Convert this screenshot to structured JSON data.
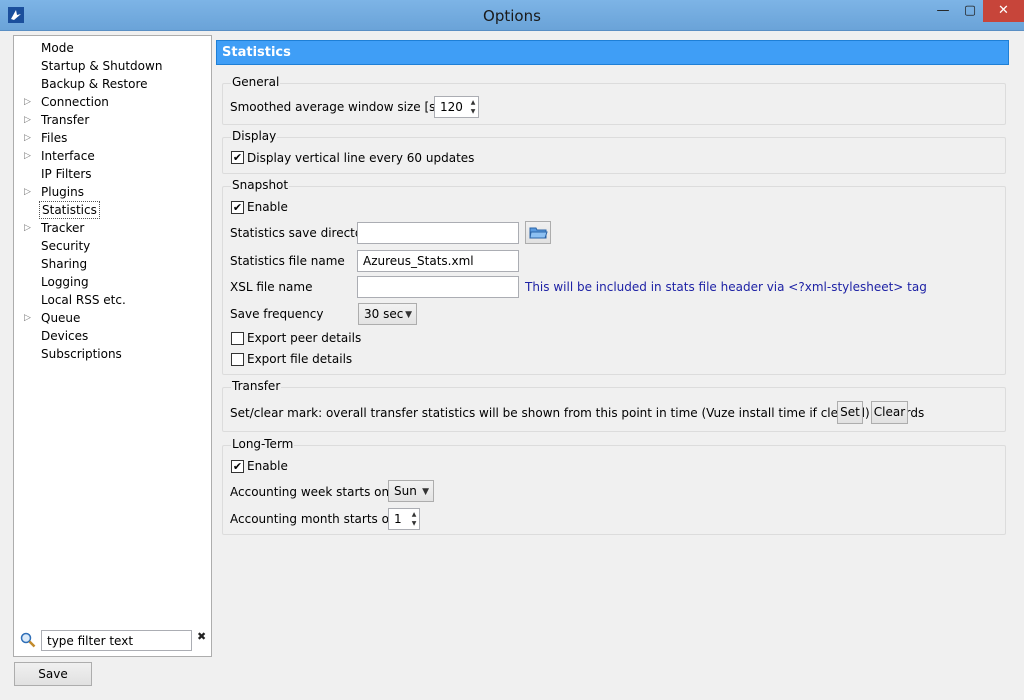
{
  "window": {
    "title": "Options",
    "min_glyph": "—",
    "max_glyph": "▢",
    "close_glyph": "✕"
  },
  "sidebar": {
    "items": [
      {
        "label": "Mode",
        "has_children": false
      },
      {
        "label": "Startup & Shutdown",
        "has_children": false
      },
      {
        "label": "Backup & Restore",
        "has_children": false
      },
      {
        "label": "Connection",
        "has_children": true
      },
      {
        "label": "Transfer",
        "has_children": true
      },
      {
        "label": "Files",
        "has_children": true
      },
      {
        "label": "Interface",
        "has_children": true
      },
      {
        "label": "IP Filters",
        "has_children": false
      },
      {
        "label": "Plugins",
        "has_children": true
      },
      {
        "label": "Statistics",
        "has_children": false,
        "selected": true
      },
      {
        "label": "Tracker",
        "has_children": true
      },
      {
        "label": "Security",
        "has_children": false
      },
      {
        "label": "Sharing",
        "has_children": false
      },
      {
        "label": "Logging",
        "has_children": false
      },
      {
        "label": "Local RSS etc.",
        "has_children": false
      },
      {
        "label": "Queue",
        "has_children": true
      },
      {
        "label": "Devices",
        "has_children": false
      },
      {
        "label": "Subscriptions",
        "has_children": false
      }
    ],
    "filter_placeholder": "type filter text",
    "filter_value": "type filter text",
    "filter_clear_glyph": "✖"
  },
  "footer": {
    "save_label": "Save"
  },
  "panel": {
    "title": "Statistics",
    "general": {
      "title": "General",
      "window_size_label": "Smoothed average window size [secs]",
      "window_size_value": "120"
    },
    "display": {
      "title": "Display",
      "vertical_line_label": "Display vertical line every 60 updates",
      "vertical_line_checked": true
    },
    "snapshot": {
      "title": "Snapshot",
      "enable_label": "Enable",
      "enable_checked": true,
      "save_dir_label": "Statistics save directory",
      "save_dir_value": "",
      "file_name_label": "Statistics file name",
      "file_name_value": "Azureus_Stats.xml",
      "xsl_label": "XSL file name",
      "xsl_value": "",
      "xsl_hint": "This will be included in stats file header via <?xml-stylesheet> tag",
      "frequency_label": "Save frequency",
      "frequency_value": "30 sec",
      "export_peer_label": "Export peer details",
      "export_peer_checked": false,
      "export_file_label": "Export file details",
      "export_file_checked": false
    },
    "transfer": {
      "title": "Transfer",
      "mark_label": "Set/clear mark: overall transfer statistics will be shown from this point in time (Vuze install time if cleared) onwards",
      "set_label": "Set",
      "clear_label": "Clear"
    },
    "longterm": {
      "title": "Long-Term",
      "enable_label": "Enable",
      "enable_checked": true,
      "week_label": "Accounting week starts on:",
      "week_value": "Sun",
      "month_label": "Accounting month starts on:",
      "month_value": "1"
    }
  },
  "colors": {
    "titlebar": "#6aa3d8",
    "header": "#3f9ef6",
    "hint": "#1e22a5",
    "close": "#c7453a"
  }
}
